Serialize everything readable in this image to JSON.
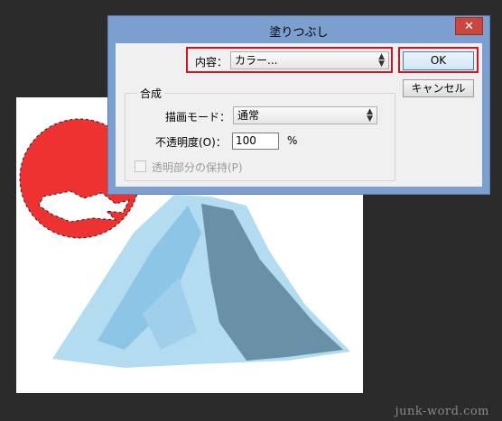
{
  "dialog": {
    "title": "塗りつぶし",
    "close_glyph": "✕",
    "contents_label": "内容：",
    "contents_value": "カラー...",
    "ok_label": "OK",
    "cancel_label": "キャンセル",
    "blending_title": "合成",
    "mode_label": "描画モード：",
    "mode_value": "通常",
    "opacity_label": "不透明度(O)：",
    "opacity_value": "100",
    "opacity_unit": "%",
    "preserve_label": "透明部分の保持(P)",
    "preserve_checked": false,
    "select_arrow_glyph": "⬍"
  },
  "watermark": "junk-word.com",
  "colors": {
    "sun": "#ee3131",
    "highlight": "#d1141d",
    "mountain_light": "#b3dcf1",
    "mountain_mid": "#8cc5e5",
    "mountain_dark": "#6a90a8",
    "dialog_frame": "#7c9fcf"
  }
}
